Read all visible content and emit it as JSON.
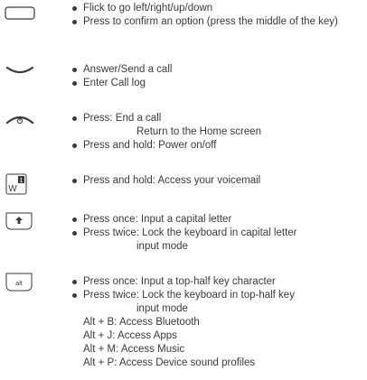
{
  "items": [
    {
      "icon": "navigation-key-icon",
      "bullets": [
        "Flick to go left/right/up/down",
        "Press to confirm an option (press the middle of the key)"
      ]
    },
    {
      "icon": "send-key-icon",
      "bullets": [
        "Answer/Send a call",
        "Enter Call log"
      ]
    },
    {
      "icon": "end-key-icon",
      "bullets": [
        "Press: End a call"
      ],
      "continuation": "Return to the Home screen",
      "bullets_after": [
        "Press and hold: Power on/off"
      ]
    },
    {
      "icon": "voicemail-key-icon",
      "icon_letter": "W",
      "icon_badge": "1",
      "bullets": [
        "Press and hold: Access your voicemail"
      ]
    },
    {
      "icon": "shift-key-icon",
      "bullets": [
        "Press once: Input a capital letter",
        "Press twice: Lock the keyboard in capital letter"
      ],
      "continuation": "input mode"
    },
    {
      "icon": "alt-key-icon",
      "icon_label": "alt",
      "bullets": [
        "Press once: Input a top-half key character",
        "Press twice: Lock the keyboard in top-half key"
      ],
      "continuation": "input mode",
      "shortcuts": [
        "Alt + B: Access Bluetooth",
        "Alt + J: Access Apps",
        "Alt + M: Access Music",
        "Alt + P: Access Device sound profiles"
      ]
    }
  ]
}
